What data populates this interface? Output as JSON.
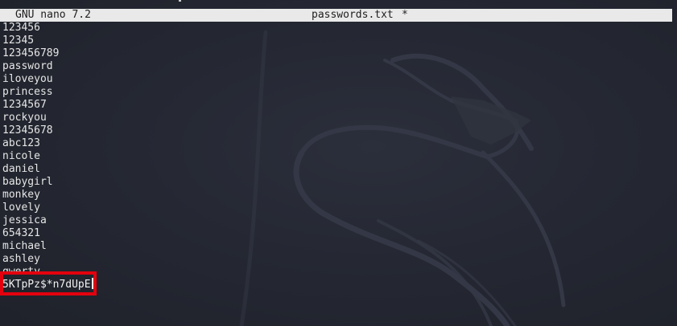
{
  "header": {
    "app_title": "GNU nano 7.2",
    "file_name": "passwords.txt",
    "modified_flag": "*"
  },
  "file": {
    "lines": [
      "123456",
      "12345",
      "123456789",
      "password",
      "iloveyou",
      "princess",
      "1234567",
      "rockyou",
      "12345678",
      "abc123",
      "nicole",
      "daniel",
      "babygirl",
      "monkey",
      "lovely",
      "jessica",
      "654321",
      "michael",
      "ashley"
    ],
    "clipped_line": "qwerty",
    "current_line": "5KTpPz$*n7dUpE"
  },
  "annotation": {
    "color": "#e3000e"
  },
  "theme": {
    "background": "#23262f",
    "header_bg": "#e9e9e9",
    "text": "#e6e6e6"
  },
  "icons": {
    "background": "kali-dragon-logo"
  }
}
